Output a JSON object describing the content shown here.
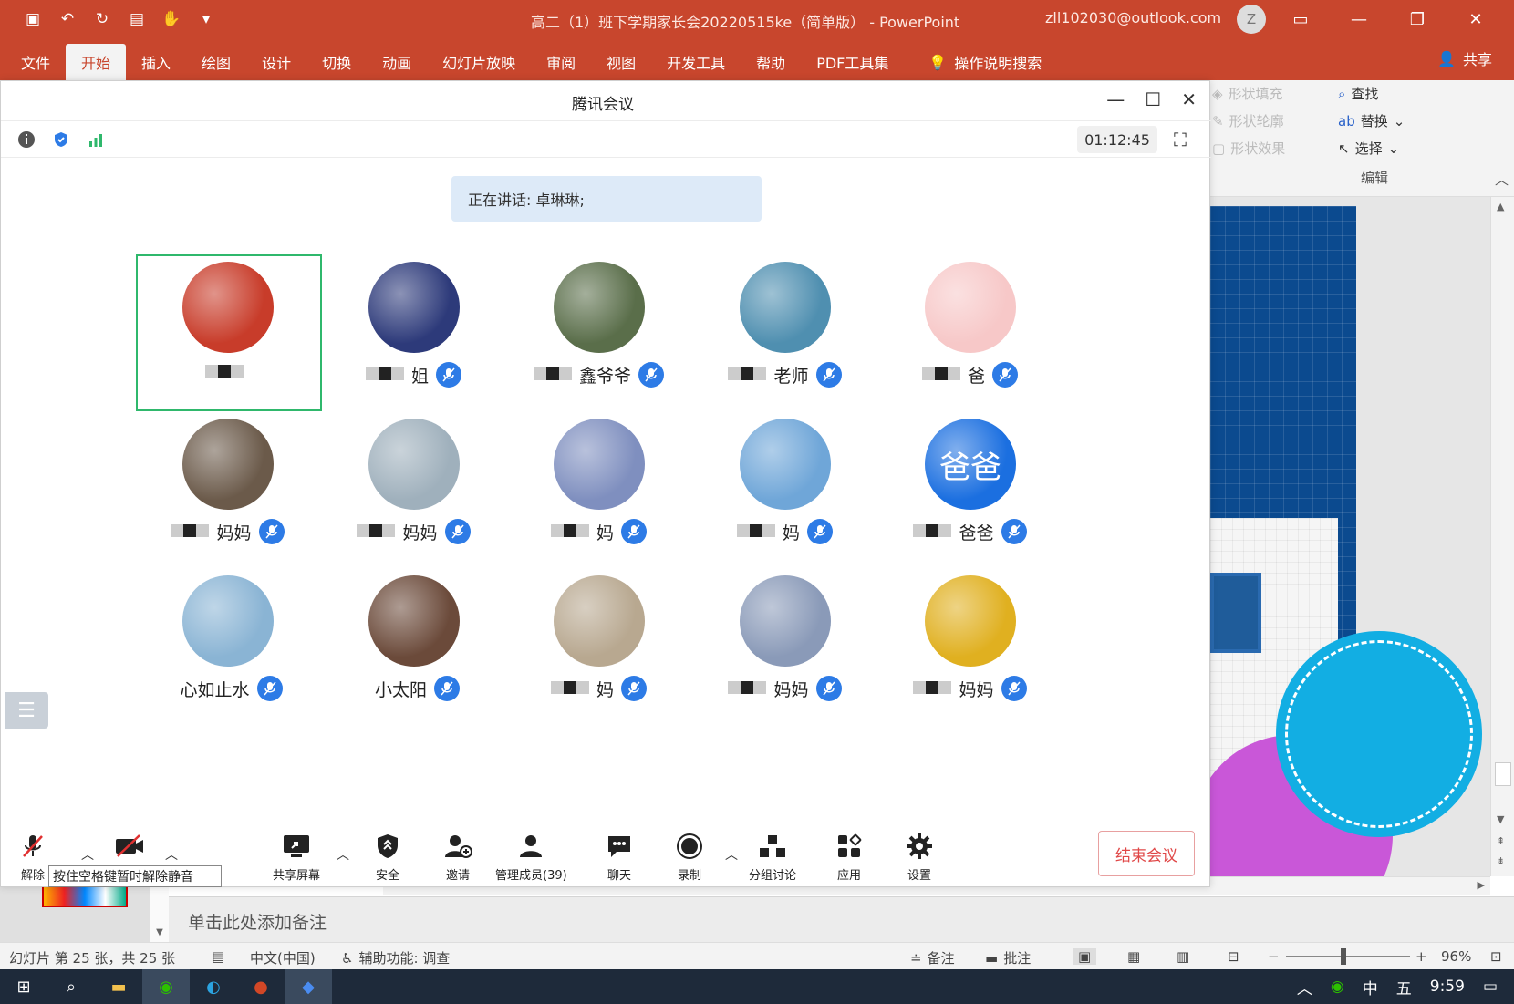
{
  "ppt": {
    "title": "高二（1）班下学期家长会20220515ke（简单版） - PowerPoint",
    "account": "zll102030@outlook.com",
    "avatar_letter": "Z",
    "tabs": [
      "文件",
      "开始",
      "插入",
      "绘图",
      "设计",
      "切换",
      "动画",
      "幻灯片放映",
      "审阅",
      "视图",
      "开发工具",
      "帮助",
      "PDF工具集"
    ],
    "active_tab": "开始",
    "search": "操作说明搜索",
    "share": "共享",
    "ribbon": {
      "shape_fill": "形状填充",
      "shape_outline": "形状轮廓",
      "shape_effect": "形状效果",
      "find": "查找",
      "replace": "替换",
      "select": "选择",
      "edit_group": "编辑"
    },
    "notes_placeholder": "单击此处添加备注",
    "status": {
      "slide_info": "幻灯片 第 25 张，共 25 张",
      "language": "中文(中国)",
      "accessibility": "辅助功能: 调查",
      "notes": "备注",
      "comments": "批注",
      "zoom": "96%",
      "zoom_level": 0.46
    }
  },
  "taskbar": {
    "ime_lang": "中",
    "ime_mode": "五",
    "clock": "9:59"
  },
  "meeting": {
    "window_title": "腾讯会议",
    "timer": "01:12:45",
    "speaking": "正在讲话: 卓琳琳;",
    "participants": [
      {
        "name": "",
        "color": "#c83c2a",
        "selected": true
      },
      {
        "name": "姐",
        "color": "#2d3a7a"
      },
      {
        "name": "鑫爷爷",
        "color": "#5a6e4a"
      },
      {
        "name": "老师",
        "color": "#4f8fb0"
      },
      {
        "name": "爸",
        "color": "#f7c8c8"
      },
      {
        "name": "妈妈",
        "color": "#6b5a4a"
      },
      {
        "name": "妈妈",
        "color": "#9fb0bc"
      },
      {
        "name": "妈",
        "color": "#7f8fbf"
      },
      {
        "name": "妈",
        "color": "#6fa6d8"
      },
      {
        "name": "爸爸",
        "color": "#1b6fe0",
        "initials": "爸爸"
      },
      {
        "name": "心如止水",
        "color": "#8ab4d4"
      },
      {
        "name": "小太阳",
        "color": "#6b4a3a"
      },
      {
        "name": "妈",
        "color": "#b8a890"
      },
      {
        "name": "妈妈",
        "color": "#8a9ab8"
      },
      {
        "name": "妈妈",
        "color": "#e0b020"
      }
    ],
    "toolbar": {
      "unmute": "解除",
      "unmute_tooltip": "按住空格键暂时解除静音",
      "share_screen": "共享屏幕",
      "security": "安全",
      "invite": "邀请",
      "members": "管理成员(39)",
      "chat": "聊天",
      "record": "录制",
      "breakout": "分组讨论",
      "apps": "应用",
      "settings": "设置",
      "end": "结束会议"
    }
  }
}
